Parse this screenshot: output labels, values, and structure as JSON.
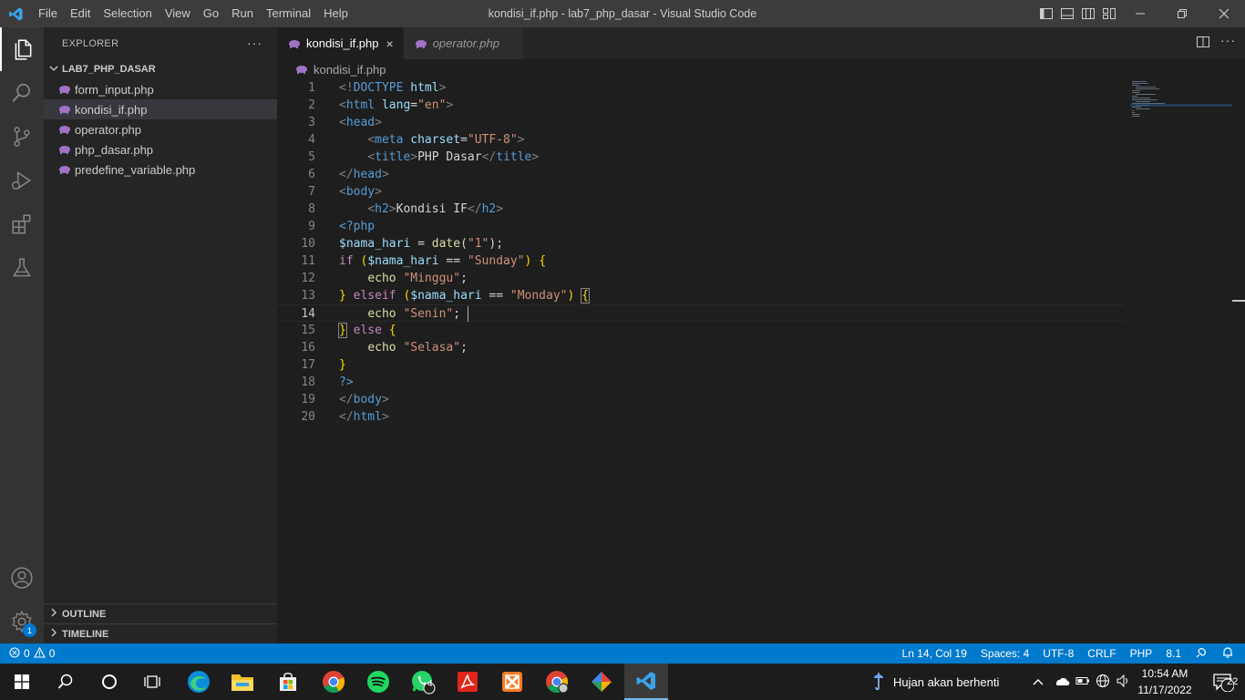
{
  "window": {
    "title": "kondisi_if.php - lab7_php_dasar - Visual Studio Code",
    "menu": [
      "File",
      "Edit",
      "Selection",
      "View",
      "Go",
      "Run",
      "Terminal",
      "Help"
    ]
  },
  "sidebar": {
    "header": "EXPLORER",
    "more": "···",
    "folder": "LAB7_PHP_DASAR",
    "files": [
      "form_input.php",
      "kondisi_if.php",
      "operator.php",
      "php_dasar.php",
      "predefine_variable.php"
    ],
    "selected_file": "kondisi_if.php",
    "outline": "OUTLINE",
    "timeline": "TIMELINE"
  },
  "activity": {
    "accounts_badge": "1"
  },
  "tabs": [
    {
      "label": "kondisi_if.php",
      "active": true,
      "close": "×"
    },
    {
      "label": "operator.php",
      "active": false
    }
  ],
  "breadcrumb": "kondisi_if.php",
  "editor": {
    "current_line": 14,
    "lines": [
      {
        "n": "1"
      },
      {
        "n": "2"
      },
      {
        "n": "3"
      },
      {
        "n": "4"
      },
      {
        "n": "5"
      },
      {
        "n": "6"
      },
      {
        "n": "7"
      },
      {
        "n": "8"
      },
      {
        "n": "9"
      },
      {
        "n": "10"
      },
      {
        "n": "11"
      },
      {
        "n": "12"
      },
      {
        "n": "13"
      },
      {
        "n": "14"
      },
      {
        "n": "15"
      },
      {
        "n": "16"
      },
      {
        "n": "17"
      },
      {
        "n": "18"
      },
      {
        "n": "19"
      },
      {
        "n": "20"
      }
    ],
    "tokens": {
      "l1": [
        "<!",
        "DOCTYPE",
        " html",
        ">"
      ],
      "l2": [
        "<",
        "html",
        " lang",
        "=",
        "\"en\"",
        ">"
      ],
      "l3": [
        "<",
        "head",
        ">"
      ],
      "l4": [
        "    ",
        "<",
        "meta",
        " charset",
        "=",
        "\"UTF-8\"",
        ">"
      ],
      "l5": [
        "    ",
        "<",
        "title",
        ">",
        "PHP Dasar",
        "</",
        "title",
        ">"
      ],
      "l6": [
        "</",
        "head",
        ">"
      ],
      "l7": [
        "<",
        "body",
        ">"
      ],
      "l8": [
        "    ",
        "<",
        "h2",
        ">",
        "Kondisi IF",
        "</",
        "h2",
        ">"
      ],
      "l9": [
        "<?php"
      ],
      "l10": [
        "$nama_hari",
        " = ",
        "date",
        "(",
        "\"1\"",
        ");"
      ],
      "l11": [
        "if",
        " ",
        "(",
        "$nama_hari",
        " == ",
        "\"Sunday\"",
        ")",
        " ",
        "{"
      ],
      "l12": [
        "    ",
        "echo",
        " ",
        "\"Minggu\"",
        ";"
      ],
      "l13": [
        "}",
        " ",
        "elseif",
        " ",
        "(",
        "$nama_hari",
        " == ",
        "\"Monday\"",
        ")",
        " ",
        "{"
      ],
      "l14": [
        "    ",
        "echo",
        " ",
        "\"Senin\"",
        "; "
      ],
      "l15": [
        "}",
        " ",
        "else",
        " ",
        "{"
      ],
      "l16": [
        "    ",
        "echo",
        " ",
        "\"Selasa\"",
        ";"
      ],
      "l17": [
        "}"
      ],
      "l18": [
        "?>"
      ],
      "l19": [
        "</",
        "body",
        ">"
      ],
      "l20": [
        "</",
        "html",
        ">"
      ]
    }
  },
  "statusbar": {
    "errors": "0",
    "warnings": "0",
    "position": "Ln 14, Col 19",
    "spaces": "Spaces: 4",
    "encoding": "UTF-8",
    "eol": "CRLF",
    "language": "PHP",
    "version": "8.1"
  },
  "taskbar": {
    "weather": "Hujan akan berhenti",
    "time": "10:54 AM",
    "date": "11/17/2022",
    "notifications": "22",
    "whatsapp_badge": "4"
  },
  "colors": {
    "titlebar": "#3c3c3c",
    "activitybar": "#333333",
    "sidebar": "#252526",
    "editor": "#1e1e1e",
    "statusbar": "#007acc",
    "php_icon": "#a074c4"
  },
  "icons": [
    "vscode-logo-icon",
    "explorer-icon",
    "search-icon",
    "source-control-icon",
    "run-debug-icon",
    "extensions-icon",
    "testing-icon",
    "accounts-icon",
    "manage-gear-icon",
    "php-elephant-icon",
    "split-editor-icon"
  ]
}
